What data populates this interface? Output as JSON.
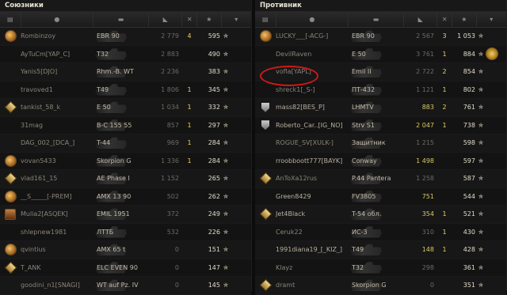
{
  "left_panel": {
    "title": "Союзники",
    "rows": [
      {
        "ach": "icon",
        "name": "Rombinzoy",
        "tank": "EBR 90",
        "dmg": "2 779",
        "frag": "4",
        "xp": "595",
        "dmgc": ""
      },
      {
        "ach": "",
        "name": "AyTuCm[YAP_C]",
        "tank": "T32",
        "dmg": "2 883",
        "frag": "",
        "xp": "490",
        "dmgc": ""
      },
      {
        "ach": "",
        "name": "Yanis5[DJO]",
        "tank": "Rhm.-B. WT",
        "dmg": "2 236",
        "frag": "",
        "xp": "383",
        "dmgc": ""
      },
      {
        "ach": "",
        "name": "travoved1",
        "tank": "T49",
        "dmg": "1 806",
        "frag": "1",
        "xp": "345",
        "dmgc": ""
      },
      {
        "ach": "diamond",
        "name": "tankist_58_k",
        "tank": "E 50",
        "dmg": "1 034",
        "frag": "1",
        "xp": "332",
        "dmgc": ""
      },
      {
        "ach": "",
        "name": "31mag",
        "tank": "B-C 155 55",
        "dmg": "857",
        "frag": "1",
        "xp": "297",
        "dmgc": ""
      },
      {
        "ach": "",
        "name": "DAG_002_[DCA_]",
        "tank": "T-44",
        "dmg": "969",
        "frag": "1",
        "xp": "284",
        "dmgc": ""
      },
      {
        "ach": "icon",
        "name": "vovan5433",
        "tank": "Skorpion G",
        "dmg": "1 336",
        "frag": "1",
        "xp": "284",
        "dmgc": ""
      },
      {
        "ach": "diamond",
        "name": "vlad161_15",
        "tank": "AE Phase I",
        "dmg": "1 152",
        "frag": "",
        "xp": "265",
        "dmgc": ""
      },
      {
        "ach": "icon",
        "name": "__S_____[-PREM]",
        "tank": "AMX 13 90",
        "dmg": "502",
        "frag": "",
        "xp": "262",
        "dmgc": ""
      },
      {
        "ach": "badge",
        "name": "Mulia2[ASQEK]",
        "tank": "EMIL 1951",
        "dmg": "372",
        "frag": "",
        "xp": "249",
        "dmgc": ""
      },
      {
        "ach": "",
        "name": "shlepnew1981",
        "tank": "ЛТТБ",
        "dmg": "532",
        "frag": "",
        "xp": "226",
        "dmgc": ""
      },
      {
        "ach": "icon",
        "name": "qvintius",
        "tank": "AMX 65 t",
        "dmg": "0",
        "frag": "",
        "xp": "151",
        "dmgc": ""
      },
      {
        "ach": "diamond",
        "name": "T_ANK",
        "tank": "ELC EVEN 90",
        "dmg": "0",
        "frag": "",
        "xp": "147",
        "dmgc": ""
      },
      {
        "ach": "",
        "name": "goodini_n1[SNAGI]",
        "tank": "WT auf Pz. IV",
        "dmg": "0",
        "frag": "",
        "xp": "145",
        "dmgc": ""
      }
    ]
  },
  "right_panel": {
    "title": "Противник",
    "rows": [
      {
        "ach": "icon",
        "name": "LUCKY___[-ACG-]",
        "tank": "EBR 90",
        "dmg": "2 567",
        "frag": "3",
        "xp": "1 053",
        "dmgc": ""
      },
      {
        "ach": "",
        "name": "DevilRaven",
        "tank": "E 50",
        "dmg": "3 761",
        "frag": "1",
        "xp": "884",
        "dmgc": "",
        "medal": true
      },
      {
        "ach": "",
        "name": "vofla[YAPL]",
        "tank": "Emil II",
        "dmg": "2 722",
        "frag": "2",
        "xp": "854",
        "dmgc": ""
      },
      {
        "ach": "",
        "name": "shreck1[_S-]",
        "tank": "ПТ-432",
        "dmg": "1 121",
        "frag": "1",
        "xp": "802",
        "dmgc": ""
      },
      {
        "ach": "shield",
        "name": "mass82[BES_P]",
        "tank": "LHMTV",
        "dmg": "883",
        "frag": "2",
        "xp": "761",
        "dmgc": "y",
        "alive": true
      },
      {
        "ach": "shield",
        "name": "Roberto_Car..[IG_NO]",
        "tank": "Strv S1",
        "dmg": "2 047",
        "frag": "1",
        "xp": "738",
        "dmgc": "y",
        "alive": true
      },
      {
        "ach": "",
        "name": "ROGUE_SV[XULK-]",
        "tank": "Защитник",
        "dmg": "1 215",
        "frag": "",
        "xp": "598",
        "dmgc": ""
      },
      {
        "ach": "",
        "name": "rroobboott777[BAYK]",
        "tank": "Conway",
        "dmg": "1 498",
        "frag": "",
        "xp": "597",
        "dmgc": "y",
        "alive": true
      },
      {
        "ach": "diamond",
        "name": "AnToXa12rus",
        "tank": "P.44 Pantera",
        "dmg": "1 258",
        "frag": "",
        "xp": "587",
        "dmgc": ""
      },
      {
        "ach": "",
        "name": "Green8429",
        "tank": "FV3805",
        "dmg": "751",
        "frag": "",
        "xp": "544",
        "dmgc": "y",
        "alive": true
      },
      {
        "ach": "diamond",
        "name": "Jet4Black",
        "tank": "T-54 обл.",
        "dmg": "354",
        "frag": "1",
        "xp": "521",
        "dmgc": "y",
        "alive": true
      },
      {
        "ach": "",
        "name": "Ceruk22",
        "tank": "ИС-3",
        "dmg": "310",
        "frag": "1",
        "xp": "430",
        "dmgc": ""
      },
      {
        "ach": "",
        "name": "1991diana19_[_KIZ_]",
        "tank": "T49",
        "dmg": "148",
        "frag": "1",
        "xp": "428",
        "dmgc": "y",
        "alive": true
      },
      {
        "ach": "",
        "name": "Klayz",
        "tank": "T32",
        "dmg": "298",
        "frag": "",
        "xp": "361",
        "dmgc": ""
      },
      {
        "ach": "diamond",
        "name": "dramt",
        "tank": "Skorpion G",
        "dmg": "0",
        "frag": "",
        "xp": "351",
        "dmgc": ""
      }
    ]
  },
  "header_icons": [
    "list-icon",
    "player-icon",
    "tank-icon",
    "damage-icon",
    "frag-icon",
    "xp-icon",
    "star-icon"
  ],
  "star_glyph": "✯"
}
